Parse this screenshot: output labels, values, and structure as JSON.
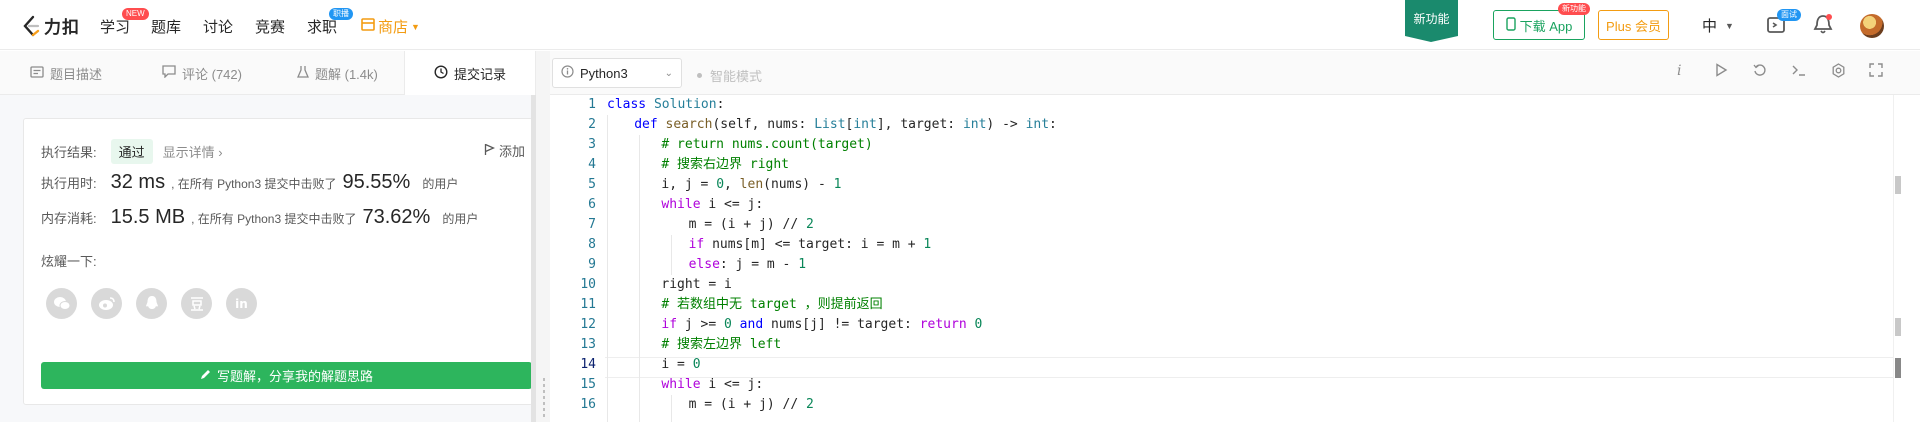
{
  "nav": {
    "logo_text": "力扣",
    "items": [
      {
        "label": "学习",
        "badge": "NEW"
      },
      {
        "label": "题库"
      },
      {
        "label": "讨论"
      },
      {
        "label": "竞赛"
      },
      {
        "label": "求职",
        "badge": "职播"
      }
    ],
    "shop_label": "商店",
    "new_feature_label": "新功能",
    "download_label": "下载 App",
    "download_badge": "新功能",
    "plus_label": "Plus 会员",
    "lang_label": "中",
    "interview_badge": "面试",
    "colors": {
      "brand_green": "#1aa35f",
      "shop_orange": "#f39c12",
      "badge_red": "#ff4d4f",
      "badge_blue": "#2196f3"
    }
  },
  "left_tabs": [
    {
      "label": "题目描述",
      "icon": "document-icon"
    },
    {
      "label": "评论 (742)",
      "icon": "comment-icon"
    },
    {
      "label": "题解 (1.4k)",
      "icon": "flask-icon"
    },
    {
      "label": "提交记录",
      "icon": "clock-icon",
      "active": true
    }
  ],
  "result": {
    "status_label": "执行结果:",
    "status_value": "通过",
    "detail_link": "显示详情",
    "add_note": "添加",
    "time_label": "执行用时:",
    "time_value": "32 ms",
    "time_desc": ", 在所有 Python3 提交中击败了",
    "time_pct": "95.55%",
    "users_suffix": "的用户",
    "mem_label": "内存消耗:",
    "mem_value": "15.5 MB",
    "mem_desc": ", 在所有 Python3 提交中击败了",
    "mem_pct": "73.62%",
    "share_label": "炫耀一下:",
    "share_icons": [
      "wechat-icon",
      "weibo-icon",
      "qq-icon",
      "douban-icon",
      "linkedin-icon"
    ],
    "write_button": "写题解，分享我的解题思路"
  },
  "editor": {
    "language": "Python3",
    "smart_mode": "智能模式",
    "toolbar_icons": [
      "info-icon",
      "run-icon",
      "reset-icon",
      "console-icon",
      "settings-icon",
      "fullscreen-icon"
    ],
    "line_numbers": [
      "1",
      "2",
      "3",
      "4",
      "5",
      "6",
      "7",
      "8",
      "9",
      "10",
      "11",
      "12",
      "13",
      "14",
      "15",
      "16"
    ],
    "current_line": 14
  }
}
